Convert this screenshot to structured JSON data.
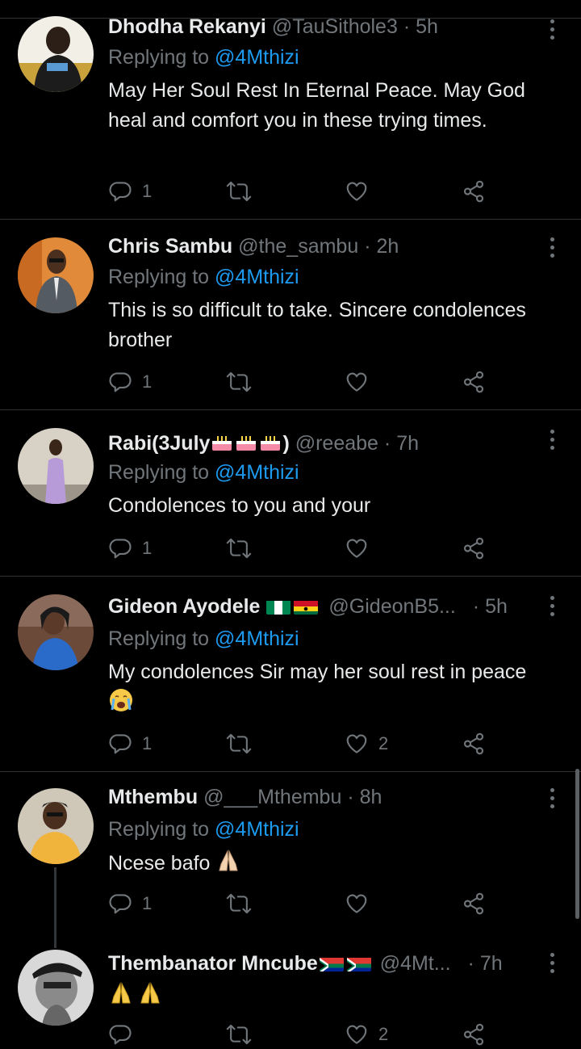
{
  "tweets": [
    {
      "name": "Dhodha Rekanyi",
      "handle": "@TauSithole3",
      "time": "5h",
      "replying_prefix": "Replying to",
      "replying_to": "@4Mthizi",
      "text": "May Her Soul Rest In Eternal Peace. May God heal and comfort you in these trying times.",
      "replies": "1",
      "likes": ""
    },
    {
      "name": "Chris Sambu",
      "handle": "@the_sambu",
      "time": "2h",
      "replying_prefix": "Replying to",
      "replying_to": "@4Mthizi",
      "text": "This is so difficult to take. Sincere condolences brother",
      "replies": "1",
      "likes": ""
    },
    {
      "name": "Rabi(3July",
      "name_suffix": ")",
      "name_emoji": "birthday-cake-emoji x3",
      "handle": "@reeabe",
      "time": "7h",
      "replying_prefix": "Replying to",
      "replying_to": "@4Mthizi",
      "text": "Condolences to you and your",
      "replies": "1",
      "likes": ""
    },
    {
      "name": "Gideon Ayodele",
      "name_flags": [
        "nigeria-flag",
        "ghana-flag"
      ],
      "handle": "@GideonB5...",
      "time": "5h",
      "replying_prefix": "Replying to",
      "replying_to": "@4Mthizi",
      "text": "My condolences Sir may her soul rest in peace",
      "text_emoji": "crying-face-emoji",
      "replies": "1",
      "likes": "2"
    },
    {
      "name": "Mthembu",
      "handle": "@___Mthembu",
      "time": "8h",
      "replying_prefix": "Replying to",
      "replying_to": "@4Mthizi",
      "text": "Ncese bafo",
      "text_emoji": "folded-hands-emoji",
      "replies": "1",
      "likes": ""
    },
    {
      "name": "Thembanator Mncube",
      "name_flags": [
        "south-africa-flag",
        "south-africa-flag"
      ],
      "handle": "@4Mt...",
      "time": "7h",
      "text_emoji": "folded-hands-emoji x2",
      "replies": "",
      "likes": "2"
    }
  ],
  "separator": "·",
  "colors": {
    "background": "#000000",
    "text": "#e7e9ea",
    "muted": "#71767b",
    "accent": "#1d9bf0",
    "divider": "#2f3336"
  },
  "icons": [
    "reply-icon",
    "retweet-icon",
    "like-icon",
    "share-icon",
    "more-icon"
  ]
}
